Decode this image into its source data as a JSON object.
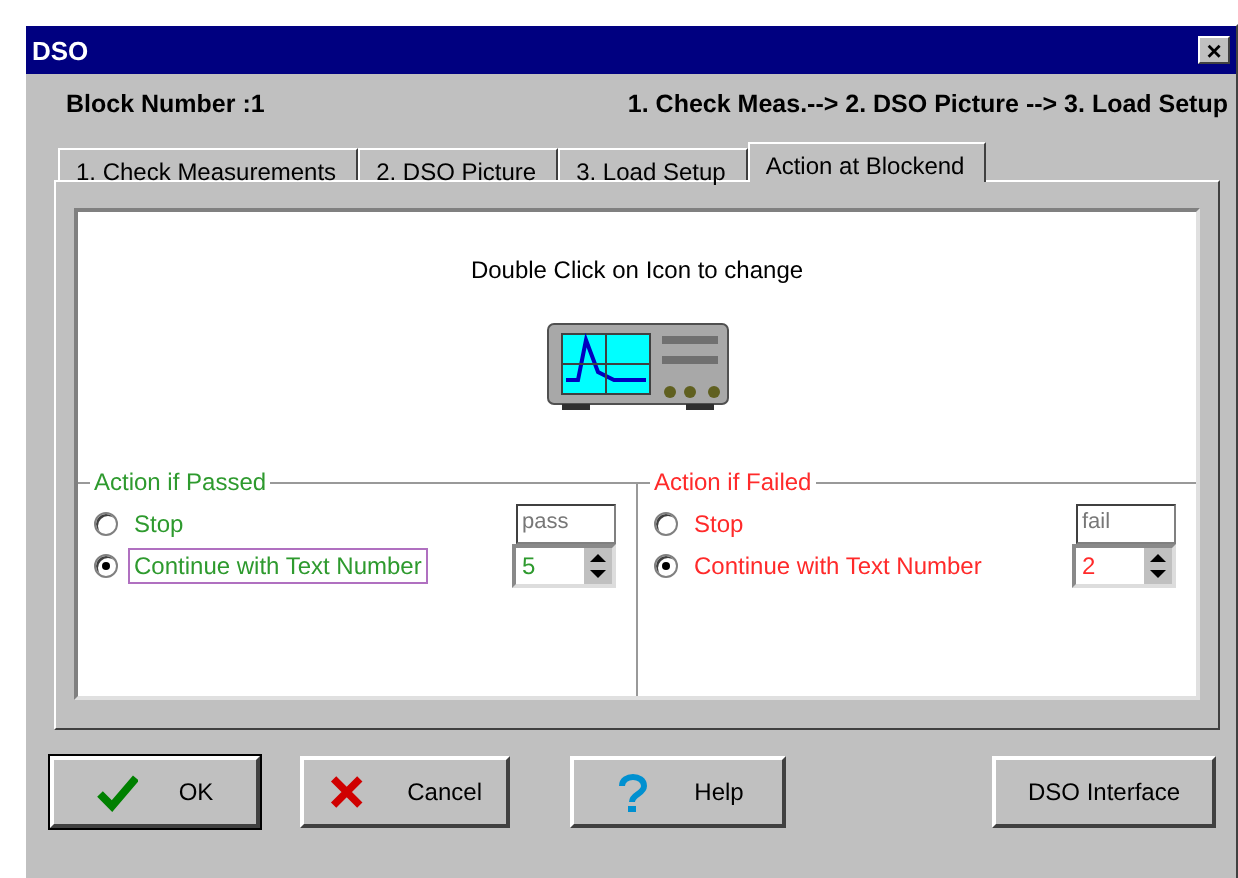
{
  "window": {
    "title": "DSO",
    "close": "×"
  },
  "header": {
    "block": "Block Number :1",
    "sequence": "1. Check Meas.--> 2. DSO Picture --> 3. Load Setup"
  },
  "tabs": [
    {
      "label": "1. Check Measurements",
      "selected": false
    },
    {
      "label": "2. DSO Picture",
      "selected": false
    },
    {
      "label": "3. Load Setup",
      "selected": false
    },
    {
      "label": "Action at Blockend",
      "selected": true
    }
  ],
  "hint": "Double Click on Icon to change",
  "groups": [
    {
      "title": "Action if Passed",
      "color": "#2e9a2e",
      "text_value": "pass",
      "spin_value": "5",
      "options": [
        {
          "label": "Stop",
          "selected": false,
          "focused": false
        },
        {
          "label": "Continue with Text Number",
          "selected": true,
          "focused": true
        }
      ]
    },
    {
      "title": "Action if Failed",
      "color": "#ff2a2a",
      "text_value": "fail",
      "spin_value": "2",
      "options": [
        {
          "label": "Stop",
          "selected": false,
          "focused": false
        },
        {
          "label": "Continue with Text Number",
          "selected": true,
          "focused": false
        }
      ]
    }
  ],
  "buttons": [
    {
      "kind": "ok",
      "label": "OK"
    },
    {
      "kind": "cancel",
      "label": "Cancel"
    },
    {
      "kind": "help",
      "label": "Help"
    },
    {
      "kind": "plain",
      "label": "DSO Interface"
    }
  ]
}
